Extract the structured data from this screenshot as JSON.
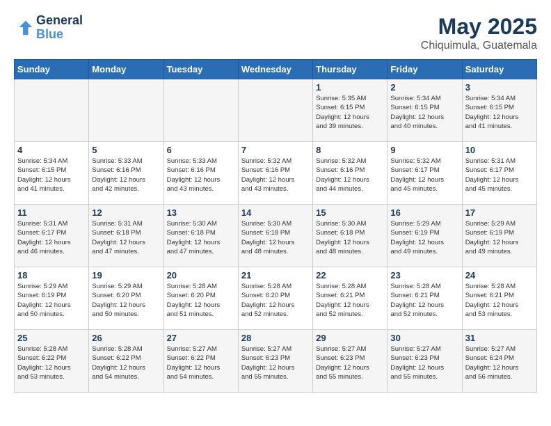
{
  "header": {
    "logo_line1": "General",
    "logo_line2": "Blue",
    "month": "May 2025",
    "location": "Chiquimula, Guatemala"
  },
  "weekdays": [
    "Sunday",
    "Monday",
    "Tuesday",
    "Wednesday",
    "Thursday",
    "Friday",
    "Saturday"
  ],
  "weeks": [
    [
      {
        "day": "",
        "info": ""
      },
      {
        "day": "",
        "info": ""
      },
      {
        "day": "",
        "info": ""
      },
      {
        "day": "",
        "info": ""
      },
      {
        "day": "1",
        "info": "Sunrise: 5:35 AM\nSunset: 6:15 PM\nDaylight: 12 hours\nand 39 minutes."
      },
      {
        "day": "2",
        "info": "Sunrise: 5:34 AM\nSunset: 6:15 PM\nDaylight: 12 hours\nand 40 minutes."
      },
      {
        "day": "3",
        "info": "Sunrise: 5:34 AM\nSunset: 6:15 PM\nDaylight: 12 hours\nand 41 minutes."
      }
    ],
    [
      {
        "day": "4",
        "info": "Sunrise: 5:34 AM\nSunset: 6:15 PM\nDaylight: 12 hours\nand 41 minutes."
      },
      {
        "day": "5",
        "info": "Sunrise: 5:33 AM\nSunset: 6:16 PM\nDaylight: 12 hours\nand 42 minutes."
      },
      {
        "day": "6",
        "info": "Sunrise: 5:33 AM\nSunset: 6:16 PM\nDaylight: 12 hours\nand 43 minutes."
      },
      {
        "day": "7",
        "info": "Sunrise: 5:32 AM\nSunset: 6:16 PM\nDaylight: 12 hours\nand 43 minutes."
      },
      {
        "day": "8",
        "info": "Sunrise: 5:32 AM\nSunset: 6:16 PM\nDaylight: 12 hours\nand 44 minutes."
      },
      {
        "day": "9",
        "info": "Sunrise: 5:32 AM\nSunset: 6:17 PM\nDaylight: 12 hours\nand 45 minutes."
      },
      {
        "day": "10",
        "info": "Sunrise: 5:31 AM\nSunset: 6:17 PM\nDaylight: 12 hours\nand 45 minutes."
      }
    ],
    [
      {
        "day": "11",
        "info": "Sunrise: 5:31 AM\nSunset: 6:17 PM\nDaylight: 12 hours\nand 46 minutes."
      },
      {
        "day": "12",
        "info": "Sunrise: 5:31 AM\nSunset: 6:18 PM\nDaylight: 12 hours\nand 47 minutes."
      },
      {
        "day": "13",
        "info": "Sunrise: 5:30 AM\nSunset: 6:18 PM\nDaylight: 12 hours\nand 47 minutes."
      },
      {
        "day": "14",
        "info": "Sunrise: 5:30 AM\nSunset: 6:18 PM\nDaylight: 12 hours\nand 48 minutes."
      },
      {
        "day": "15",
        "info": "Sunrise: 5:30 AM\nSunset: 6:18 PM\nDaylight: 12 hours\nand 48 minutes."
      },
      {
        "day": "16",
        "info": "Sunrise: 5:29 AM\nSunset: 6:19 PM\nDaylight: 12 hours\nand 49 minutes."
      },
      {
        "day": "17",
        "info": "Sunrise: 5:29 AM\nSunset: 6:19 PM\nDaylight: 12 hours\nand 49 minutes."
      }
    ],
    [
      {
        "day": "18",
        "info": "Sunrise: 5:29 AM\nSunset: 6:19 PM\nDaylight: 12 hours\nand 50 minutes."
      },
      {
        "day": "19",
        "info": "Sunrise: 5:29 AM\nSunset: 6:20 PM\nDaylight: 12 hours\nand 50 minutes."
      },
      {
        "day": "20",
        "info": "Sunrise: 5:28 AM\nSunset: 6:20 PM\nDaylight: 12 hours\nand 51 minutes."
      },
      {
        "day": "21",
        "info": "Sunrise: 5:28 AM\nSunset: 6:20 PM\nDaylight: 12 hours\nand 52 minutes."
      },
      {
        "day": "22",
        "info": "Sunrise: 5:28 AM\nSunset: 6:21 PM\nDaylight: 12 hours\nand 52 minutes."
      },
      {
        "day": "23",
        "info": "Sunrise: 5:28 AM\nSunset: 6:21 PM\nDaylight: 12 hours\nand 52 minutes."
      },
      {
        "day": "24",
        "info": "Sunrise: 5:28 AM\nSunset: 6:21 PM\nDaylight: 12 hours\nand 53 minutes."
      }
    ],
    [
      {
        "day": "25",
        "info": "Sunrise: 5:28 AM\nSunset: 6:22 PM\nDaylight: 12 hours\nand 53 minutes."
      },
      {
        "day": "26",
        "info": "Sunrise: 5:28 AM\nSunset: 6:22 PM\nDaylight: 12 hours\nand 54 minutes."
      },
      {
        "day": "27",
        "info": "Sunrise: 5:27 AM\nSunset: 6:22 PM\nDaylight: 12 hours\nand 54 minutes."
      },
      {
        "day": "28",
        "info": "Sunrise: 5:27 AM\nSunset: 6:23 PM\nDaylight: 12 hours\nand 55 minutes."
      },
      {
        "day": "29",
        "info": "Sunrise: 5:27 AM\nSunset: 6:23 PM\nDaylight: 12 hours\nand 55 minutes."
      },
      {
        "day": "30",
        "info": "Sunrise: 5:27 AM\nSunset: 6:23 PM\nDaylight: 12 hours\nand 55 minutes."
      },
      {
        "day": "31",
        "info": "Sunrise: 5:27 AM\nSunset: 6:24 PM\nDaylight: 12 hours\nand 56 minutes."
      }
    ]
  ]
}
